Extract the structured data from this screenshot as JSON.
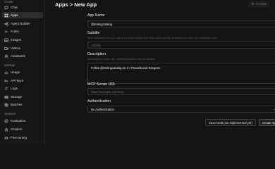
{
  "sidebar": {
    "sections": [
      {
        "label": "Create"
      },
      {
        "label": "Manage"
      },
      {
        "label": "Optimize"
      }
    ],
    "items": [
      {
        "label": "Chat",
        "icon": "chat-icon"
      },
      {
        "label": "Apps",
        "icon": "apps-icon"
      },
      {
        "label": "Agent Builder",
        "icon": "agent-builder-icon"
      },
      {
        "label": "Audio",
        "icon": "audio-icon"
      },
      {
        "label": "Images",
        "icon": "image-icon"
      },
      {
        "label": "Videos",
        "icon": "video-icon"
      },
      {
        "label": "Assistants",
        "icon": "assistants-icon"
      },
      {
        "label": "Usage",
        "icon": "usage-icon"
      },
      {
        "label": "API keys",
        "icon": "key-icon"
      },
      {
        "label": "Logs",
        "icon": "logs-icon"
      },
      {
        "label": "Storage",
        "icon": "storage-icon"
      },
      {
        "label": "Batches",
        "icon": "batches-icon"
      },
      {
        "label": "Evaluation",
        "icon": "evaluation-icon"
      },
      {
        "label": "Graders",
        "icon": "graders-icon"
      },
      {
        "label": "Fine-tuning",
        "icon": "fine-tuning-icon"
      }
    ],
    "active_item": "Apps"
  },
  "header": {
    "title": "Apps > New App",
    "preview_label": "Preview"
  },
  "form": {
    "app_name": {
      "label": "App Name",
      "value": "@testingcatalog"
    },
    "subtitle": {
      "label": "Subtitle",
      "help": "Short description for your app in a concise phrase that helps users quickly understand its value (60 characters max)",
      "placeholder": "Subtitle"
    },
    "description": {
      "label": "Description",
      "help": "A description of your app, detailing features and functionality",
      "value": "Follow @testingcatalog on X / Threads and Telegram"
    },
    "mcp_server_url": {
      "label": "MCP Server URL",
      "placeholder": "https://example.com/mcp"
    },
    "authentication": {
      "label": "Authentication",
      "selected": "No Authentication"
    }
  },
  "actions": {
    "save_draft_label": "Save Draft (not implemented yet)",
    "create_app_label": "Create App"
  },
  "colors": {
    "background": "#141414",
    "sidebar_active": "#2d2d2d",
    "field_border": "#343434"
  }
}
